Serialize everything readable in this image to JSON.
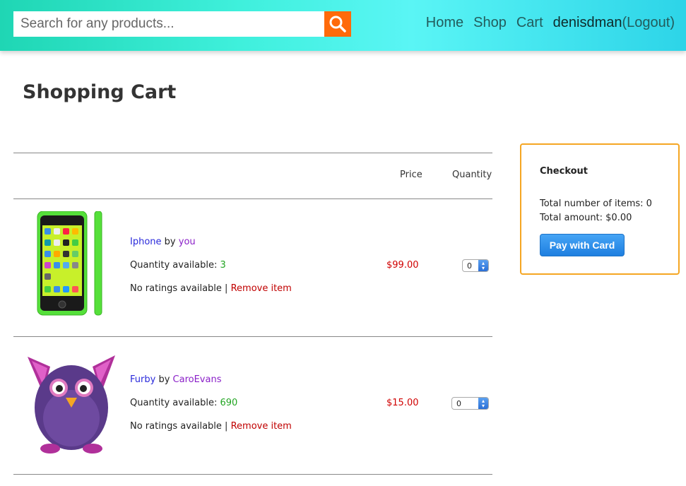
{
  "search": {
    "placeholder": "Search for any products..."
  },
  "nav": {
    "home": "Home",
    "shop": "Shop",
    "cart": "Cart",
    "user": "denisdman",
    "logout": "(Logout)"
  },
  "page": {
    "title": "Shopping Cart"
  },
  "table": {
    "price_header": "Price",
    "quantity_header": "Quantity"
  },
  "items": [
    {
      "name": "Iphone",
      "by": "by",
      "seller": "you",
      "qty_label": "Quantity available:",
      "qty_available": "3",
      "ratings": "No ratings available",
      "separator": "|",
      "remove": "Remove item",
      "price": "$99.00",
      "quantity": "0"
    },
    {
      "name": "Furby",
      "by": "by",
      "seller": "CaroEvans",
      "qty_label": "Quantity available:",
      "qty_available": "690",
      "ratings": "No ratings available",
      "separator": "|",
      "remove": "Remove item",
      "price": "$15.00",
      "quantity": "0"
    }
  ],
  "checkout": {
    "title": "Checkout",
    "total_items": "Total number of items: 0",
    "total_amount": "Total amount: $0.00",
    "pay_button": "Pay with Card"
  },
  "colors": {
    "accent": "#ff6a0a",
    "checkout_border": "#f5a623",
    "price": "#d00000",
    "available": "#22a522"
  }
}
